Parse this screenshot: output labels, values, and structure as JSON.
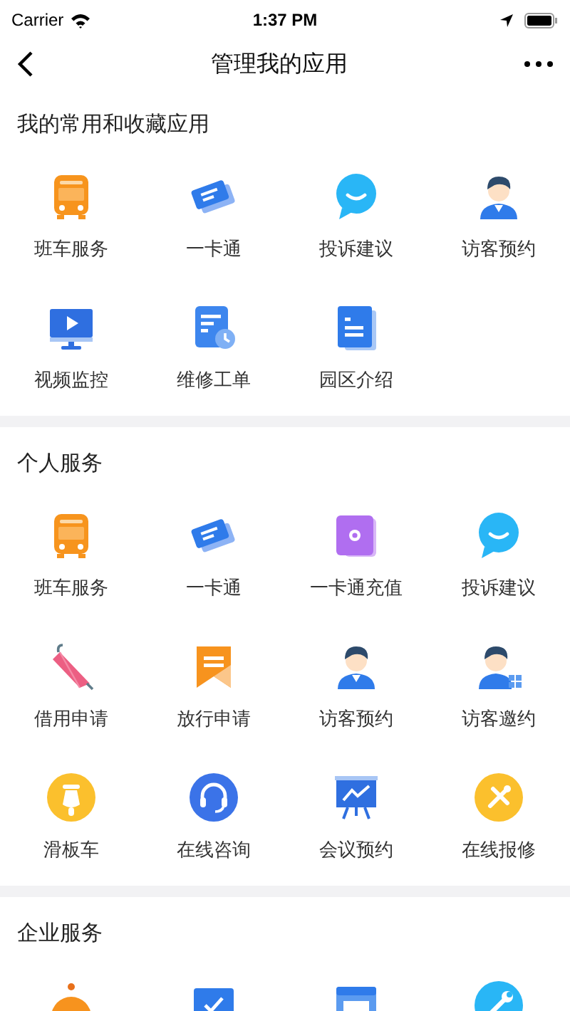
{
  "status_bar": {
    "carrier": "Carrier",
    "time": "1:37 PM"
  },
  "nav": {
    "title": "管理我的应用"
  },
  "sections": [
    {
      "title": "我的常用和收藏应用",
      "apps": [
        {
          "label": "班车服务",
          "kind": "bus"
        },
        {
          "label": "一卡通",
          "kind": "ticket"
        },
        {
          "label": "投诉建议",
          "kind": "chat"
        },
        {
          "label": "访客预约",
          "kind": "person"
        },
        {
          "label": "视频监控",
          "kind": "monitor"
        },
        {
          "label": "维修工单",
          "kind": "docclock"
        },
        {
          "label": "园区介绍",
          "kind": "doc"
        }
      ]
    },
    {
      "title": "个人服务",
      "apps": [
        {
          "label": "班车服务",
          "kind": "bus"
        },
        {
          "label": "一卡通",
          "kind": "ticket"
        },
        {
          "label": "一卡通充值",
          "kind": "card"
        },
        {
          "label": "投诉建议",
          "kind": "chat"
        },
        {
          "label": "借用申请",
          "kind": "umbrella"
        },
        {
          "label": "放行申请",
          "kind": "bookmark"
        },
        {
          "label": "访客预约",
          "kind": "person"
        },
        {
          "label": "访客邀约",
          "kind": "persongrid"
        },
        {
          "label": "滑板车",
          "kind": "scooter"
        },
        {
          "label": "在线咨询",
          "kind": "headset"
        },
        {
          "label": "会议预约",
          "kind": "board"
        },
        {
          "label": "在线报修",
          "kind": "tools"
        }
      ]
    },
    {
      "title": "企业服务",
      "apps": [
        {
          "kind": "cloche"
        },
        {
          "kind": "checkbox"
        },
        {
          "kind": "window"
        },
        {
          "kind": "wrench"
        }
      ]
    }
  ]
}
